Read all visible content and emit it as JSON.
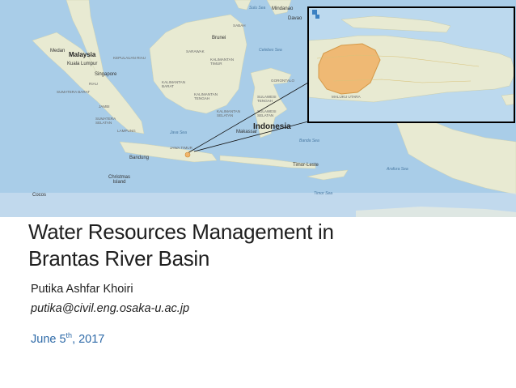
{
  "slide": {
    "title_line1": "Water Resources Management in",
    "title_line2": "Brantas River Basin",
    "author": "Putika Ashfar Khoiri",
    "email": "putika@civil.eng.osaka-u.ac.jp",
    "date_main": "June 5",
    "date_suffix": "th",
    "date_year": ", 2017"
  },
  "map": {
    "labels": {
      "medan": "Medan",
      "malaysia": "Malaysia",
      "kuala_lumpur": "Kuala Lumpur",
      "singapore": "Singapore",
      "indonesia": "Indonesia",
      "bandung": "Bandung",
      "christmas_island": "Christmas\nIsland",
      "cocos": "Cocos",
      "timor_leste": "Timor-Leste",
      "mindanao": "Mindanao",
      "davao": "Davao",
      "brunei": "Brunei",
      "makassar": "Makassar",
      "java_sea": "Java Sea",
      "banda_sea": "Banda Sea",
      "timor_sea": "Timor Sea",
      "arafura_sea": "Arafura Sea",
      "celebes_sea": "Celebes Sea",
      "sulu_sea": "Sulu Sea",
      "riau": "RIAU",
      "jambi": "JAMBI",
      "sumatera_barat": "SUMATERA BARAT",
      "sumatera_selatan": "SUMATERA\nSELATAN",
      "lampung": "LAMPUNG",
      "kalimantan_barat": "KALIMANTAN\nBARAT",
      "kalimantan_tengah": "KALIMANTAN\nTENGAH",
      "kalimantan_timur": "KALIMANTAN\nTIMUR",
      "kalimantan_selatan": "KALIMANTAN\nSELATAN",
      "sulawesi_tengah": "SULAWESI\nTENGAH",
      "sulawesi_selatan": "SULAWESI\nSELATAN",
      "jawa_timur": "JAWA TIMUR",
      "kepulauan_riau": "KEPULAUAN RIAU",
      "maluku_utara": "MALUKU UTARA",
      "sarawak": "SARAWAK",
      "sabah": "SABAH",
      "gorontalo": "GORONTALO"
    },
    "colors": {
      "sea": "#a9cde8",
      "land": "#e8ead2",
      "highlight": "#f0b46a"
    }
  }
}
